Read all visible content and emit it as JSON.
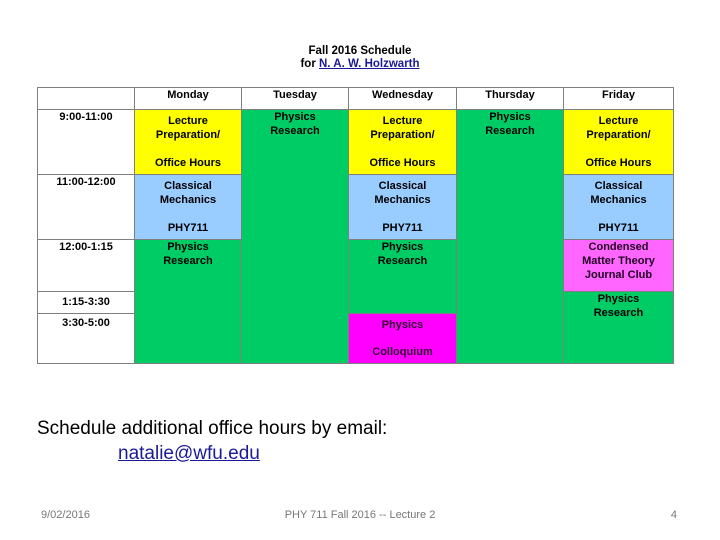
{
  "title": {
    "line1": "Fall 2016 Schedule",
    "line2_prefix": "for ",
    "owner": "N. A. W. Holzwarth"
  },
  "schedule": {
    "days": [
      "Monday",
      "Tuesday",
      "Wednesday",
      "Thursday",
      "Friday"
    ],
    "times": [
      "9:00-11:00",
      "11:00-12:00",
      "12:00-1:15",
      "1:15-3:30",
      "3:30-5:00"
    ],
    "cells": {
      "lecture_prep_line1": "Lecture",
      "lecture_prep_line2": "Preparation/",
      "office_hours": "Office Hours",
      "classical_line1": "Classical",
      "classical_line2": "Mechanics",
      "course_code": "PHY711",
      "research_line1": "Physics",
      "research_line2": "Research",
      "colloquium_line1": "Physics",
      "colloquium_line2": "Colloquium",
      "cmt_line1": "Condensed",
      "cmt_line2": "Matter Theory",
      "cmt_line3": "Journal Club"
    },
    "colors": {
      "office_hours": "#FFFF00",
      "class": "#99CCFF",
      "research": "#00CC66",
      "colloquium": "#FF00FF",
      "journal_club": "#FF66FF"
    }
  },
  "note": {
    "text": "Schedule additional office hours by email:",
    "email": "natalie@wfu.edu"
  },
  "footer": {
    "date": "9/02/2016",
    "center": "PHY 711  Fall 2016 -- Lecture 2",
    "page": "4"
  }
}
